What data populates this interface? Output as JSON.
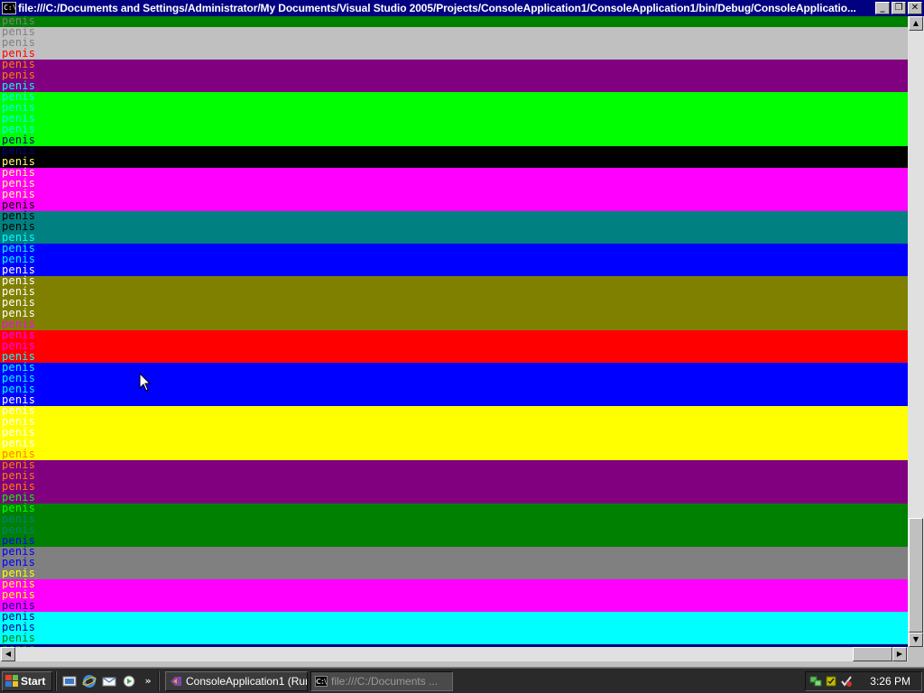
{
  "window": {
    "title": "file:///C:/Documents and Settings/Administrator/My Documents/Visual Studio 2005/Projects/ConsoleApplication1/ConsoleApplication1/bin/Debug/ConsoleApplicatio...",
    "icon_text": "C:\\",
    "minimize_label": "_",
    "restore_label": "❐",
    "close_label": "✕"
  },
  "console": {
    "word": "penis",
    "lines": [
      {
        "fg": "#808080",
        "bg": "#008000"
      },
      {
        "fg": "#808080",
        "bg": "#c0c0c0"
      },
      {
        "fg": "#808080",
        "bg": "#c0c0c0"
      },
      {
        "fg": "#ff0000",
        "bg": "#c0c0c0"
      },
      {
        "fg": "#ff8000",
        "bg": "#800080"
      },
      {
        "fg": "#ff8000",
        "bg": "#800080"
      },
      {
        "fg": "#00ffff",
        "bg": "#800080"
      },
      {
        "fg": "#00ffff",
        "bg": "#00ff00"
      },
      {
        "fg": "#00ffff",
        "bg": "#00ff00"
      },
      {
        "fg": "#00ffff",
        "bg": "#00ff00"
      },
      {
        "fg": "#00ffff",
        "bg": "#00ff00"
      },
      {
        "fg": "#000080",
        "bg": "#00ff00"
      },
      {
        "fg": "#000080",
        "bg": "#000000"
      },
      {
        "fg": "#ffff80",
        "bg": "#000000"
      },
      {
        "fg": "#ffff80",
        "bg": "#ff00ff"
      },
      {
        "fg": "#ffff80",
        "bg": "#ff00ff"
      },
      {
        "fg": "#ffff80",
        "bg": "#ff00ff"
      },
      {
        "fg": "#000000",
        "bg": "#ff00ff"
      },
      {
        "fg": "#000000",
        "bg": "#008080"
      },
      {
        "fg": "#000000",
        "bg": "#008080"
      },
      {
        "fg": "#00ffff",
        "bg": "#008080"
      },
      {
        "fg": "#00ffff",
        "bg": "#0000ff"
      },
      {
        "fg": "#00ffff",
        "bg": "#0000ff"
      },
      {
        "fg": "#ffffff",
        "bg": "#0000ff"
      },
      {
        "fg": "#ffffff",
        "bg": "#808000"
      },
      {
        "fg": "#ffffff",
        "bg": "#808000"
      },
      {
        "fg": "#ffffff",
        "bg": "#808000"
      },
      {
        "fg": "#ffffff",
        "bg": "#808000"
      },
      {
        "fg": "#ff00ff",
        "bg": "#808000"
      },
      {
        "fg": "#ff00ff",
        "bg": "#ff0000"
      },
      {
        "fg": "#ff00ff",
        "bg": "#ff0000"
      },
      {
        "fg": "#00ffff",
        "bg": "#ff0000"
      },
      {
        "fg": "#00ffff",
        "bg": "#0000ff"
      },
      {
        "fg": "#00ffff",
        "bg": "#0000ff"
      },
      {
        "fg": "#00ffff",
        "bg": "#0000ff"
      },
      {
        "fg": "#ffffff",
        "bg": "#0000ff"
      },
      {
        "fg": "#ffffff",
        "bg": "#ffff00"
      },
      {
        "fg": "#ffffff",
        "bg": "#ffff00"
      },
      {
        "fg": "#ffffff",
        "bg": "#ffff00"
      },
      {
        "fg": "#ffffff",
        "bg": "#ffff00"
      },
      {
        "fg": "#ff8000",
        "bg": "#ffff00"
      },
      {
        "fg": "#ff8000",
        "bg": "#800080"
      },
      {
        "fg": "#ff8000",
        "bg": "#800080"
      },
      {
        "fg": "#ff8000",
        "bg": "#800080"
      },
      {
        "fg": "#00ff00",
        "bg": "#800080"
      },
      {
        "fg": "#00ff00",
        "bg": "#008000"
      },
      {
        "fg": "#008080",
        "bg": "#008000"
      },
      {
        "fg": "#008080",
        "bg": "#008000"
      },
      {
        "fg": "#0000ff",
        "bg": "#008000"
      },
      {
        "fg": "#0000ff",
        "bg": "#808080"
      },
      {
        "fg": "#0000ff",
        "bg": "#808080"
      },
      {
        "fg": "#ffff00",
        "bg": "#808080"
      },
      {
        "fg": "#ffff00",
        "bg": "#ff00ff"
      },
      {
        "fg": "#ffff00",
        "bg": "#ff00ff"
      },
      {
        "fg": "#000080",
        "bg": "#ff00ff"
      },
      {
        "fg": "#000080",
        "bg": "#00ffff"
      },
      {
        "fg": "#000080",
        "bg": "#00ffff"
      },
      {
        "fg": "#008000",
        "bg": "#00ffff"
      },
      {
        "fg": "#008000",
        "bg": "#000080"
      },
      {
        "fg": "#008000",
        "bg": "#000080"
      }
    ]
  },
  "scrollbars": {
    "up_glyph": "▲",
    "down_glyph": "▼",
    "left_glyph": "◀",
    "right_glyph": "▶"
  },
  "taskbar": {
    "start_label": "Start",
    "quick_launch_chevron": "»",
    "tasks": [
      {
        "label": "ConsoleApplication1 (Run...",
        "icon": "visual-studio-icon",
        "active": false
      },
      {
        "label": "file:///C:/Documents ...",
        "icon": "console-icon",
        "active": true
      }
    ],
    "clock": "3:26 PM"
  },
  "colors": {
    "titlebar": "#000080",
    "taskbar": "#2a2a2a",
    "window_frame": "#c0c0c0"
  }
}
